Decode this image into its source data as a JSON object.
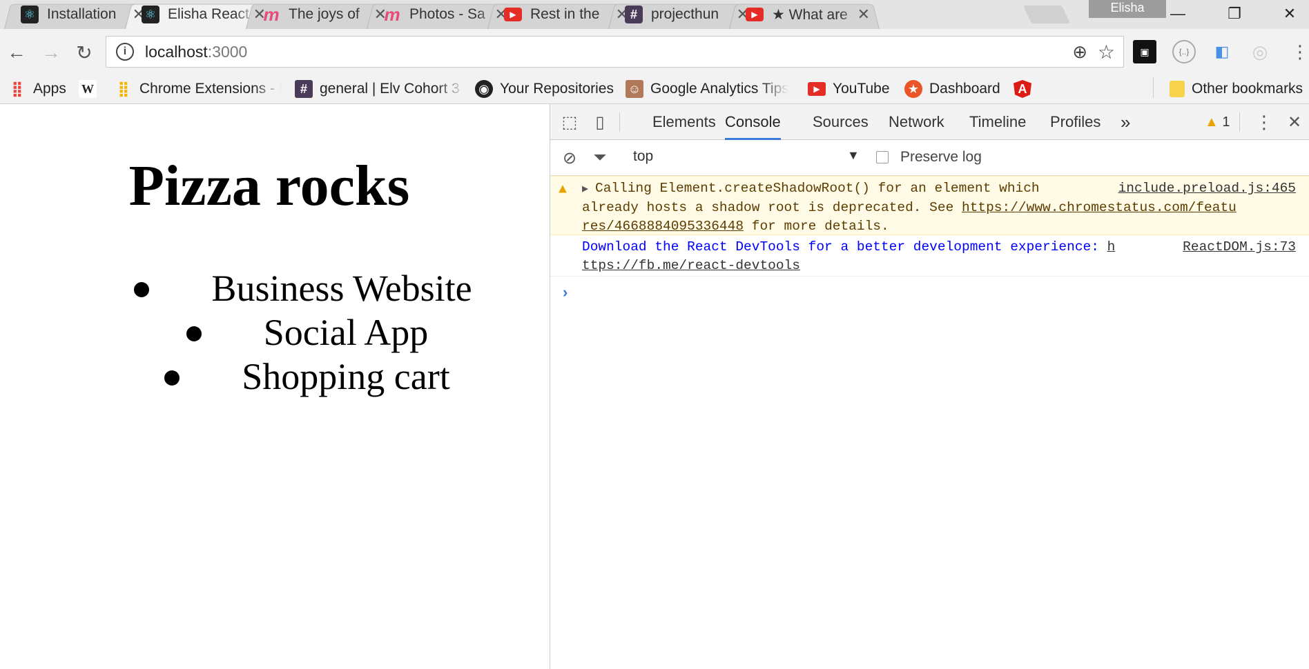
{
  "tabs": [
    {
      "title": "Installation",
      "icon": "react-icon",
      "color": "#61dafb",
      "active": false
    },
    {
      "title": "Elisha React",
      "icon": "react-icon",
      "color": "#61dafb",
      "active": true
    },
    {
      "title": "The joys of",
      "icon": "medium-icon",
      "color": "#e64c7a",
      "active": false
    },
    {
      "title": "Photos - Sa",
      "icon": "medium-icon",
      "color": "#e64c7a",
      "active": false
    },
    {
      "title": "Rest in the",
      "icon": "youtube-icon",
      "color": "#e52d27",
      "active": false
    },
    {
      "title": "projecthun",
      "icon": "slack-hash-icon",
      "color": "#4a3c58",
      "active": false
    },
    {
      "title": "★ What are",
      "icon": "youtube-icon",
      "color": "#e52d27",
      "active": false
    }
  ],
  "window": {
    "profile": "Elisha"
  },
  "address": {
    "host": "localhost",
    "port": ":3000"
  },
  "bookmarks": {
    "apps": "Apps",
    "wiki": "W",
    "chrome_ext": "Chrome Extensions - F",
    "general": "general | Elv Cohort 3",
    "repos": "Your Repositories",
    "analytics": "Google Analytics Tips",
    "youtube": "YouTube",
    "dashboard": "Dashboard",
    "other": "Other bookmarks"
  },
  "page": {
    "heading": "Pizza rocks",
    "items": [
      "Business Website",
      "Social App",
      "Shopping cart"
    ]
  },
  "devtools": {
    "tabs": [
      "Elements",
      "Console",
      "Sources",
      "Network",
      "Timeline",
      "Profiles"
    ],
    "active_tab": "Console",
    "more": "»",
    "warning_count": "1",
    "context": "top",
    "preserve_log": "Preserve log",
    "messages": {
      "warn": {
        "line1": "Calling Element.createShadowRoot() for an element which",
        "line2": "already hosts a shadow root is deprecated. See",
        "link_a": "https://www.chromestatus.com/featu",
        "link_b": "res/4668884095336448",
        "line3_rest": " for more details.",
        "source": "include.preload.js:465"
      },
      "info": {
        "line1": "Download the React DevTools for a better development experience:",
        "link_a": "h",
        "link_b": "ttps://fb.me/react-devtools",
        "source": "ReactDOM.js:73"
      }
    },
    "prompt": "›"
  }
}
